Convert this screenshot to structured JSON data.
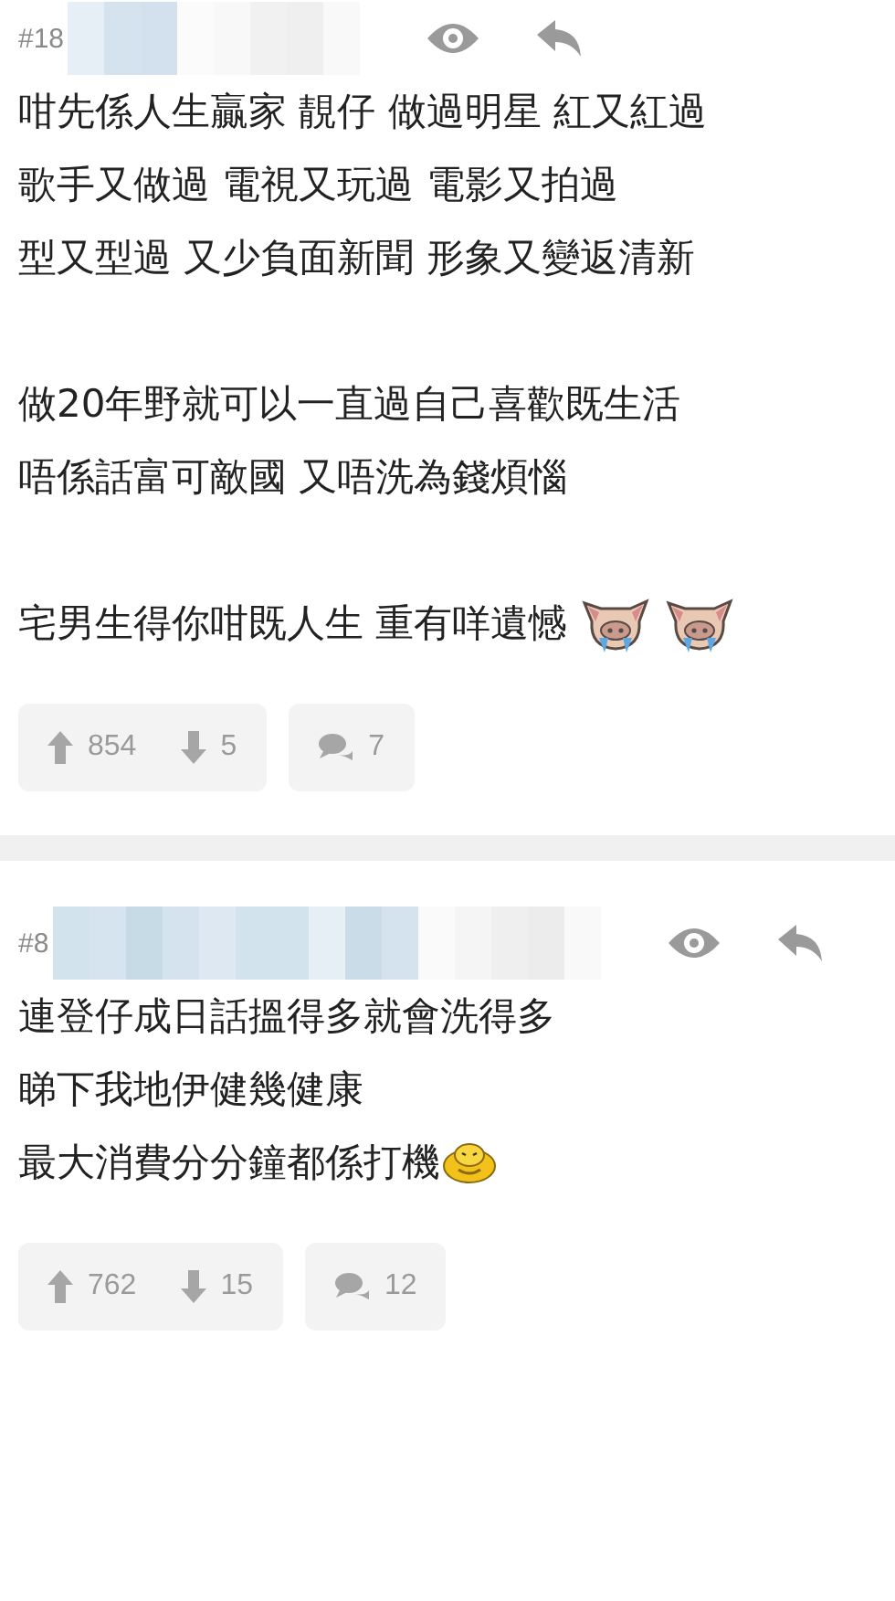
{
  "posts": [
    {
      "number": "#18",
      "paragraphs": [
        {
          "lines": [
            {
              "text": "咁先係人生贏家 靚仔 做過明星 紅又紅過"
            },
            {
              "text": "歌手又做過 電視又玩過 電影又拍過"
            },
            {
              "text": "型又型過 又少負面新聞 形象又變返清新"
            }
          ]
        },
        {
          "lines": [
            {
              "text": "做20年野就可以一直過自己喜歡既生活"
            },
            {
              "text": "唔係話富可敵國 又唔洗為錢煩惱"
            }
          ]
        },
        {
          "lines": [
            {
              "text": "宅男生得你咁既人生 重有咩遺憾",
              "stickers": [
                {
                  "kind": "pig"
                },
                {
                  "kind": "pig"
                }
              ]
            }
          ]
        }
      ],
      "upvotes": "854",
      "downvotes": "5",
      "replies": "7"
    },
    {
      "number": "#8",
      "paragraphs": [
        {
          "lines": [
            {
              "text": "連登仔成日話搵得多就會洗得多"
            },
            {
              "text": "睇下我地伊健幾健康"
            },
            {
              "text": "最大消費分分鐘都係打機",
              "stickers": [
                {
                  "kind": "yellow-face"
                }
              ]
            }
          ]
        }
      ],
      "upvotes": "762",
      "downvotes": "15",
      "replies": "12"
    }
  ]
}
